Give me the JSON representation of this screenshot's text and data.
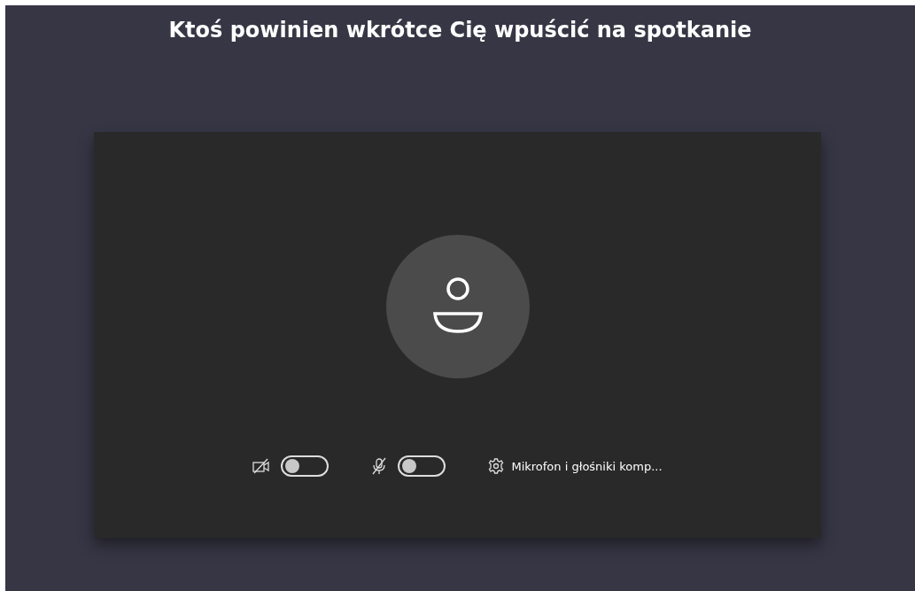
{
  "title": "Ktoś powinien wkrótce Cię wpuścić na spotkanie",
  "controls": {
    "camera": {
      "on": false
    },
    "microphone": {
      "on": false
    },
    "device_settings": {
      "label": "Mikrofon i głośniki komp..."
    }
  }
}
